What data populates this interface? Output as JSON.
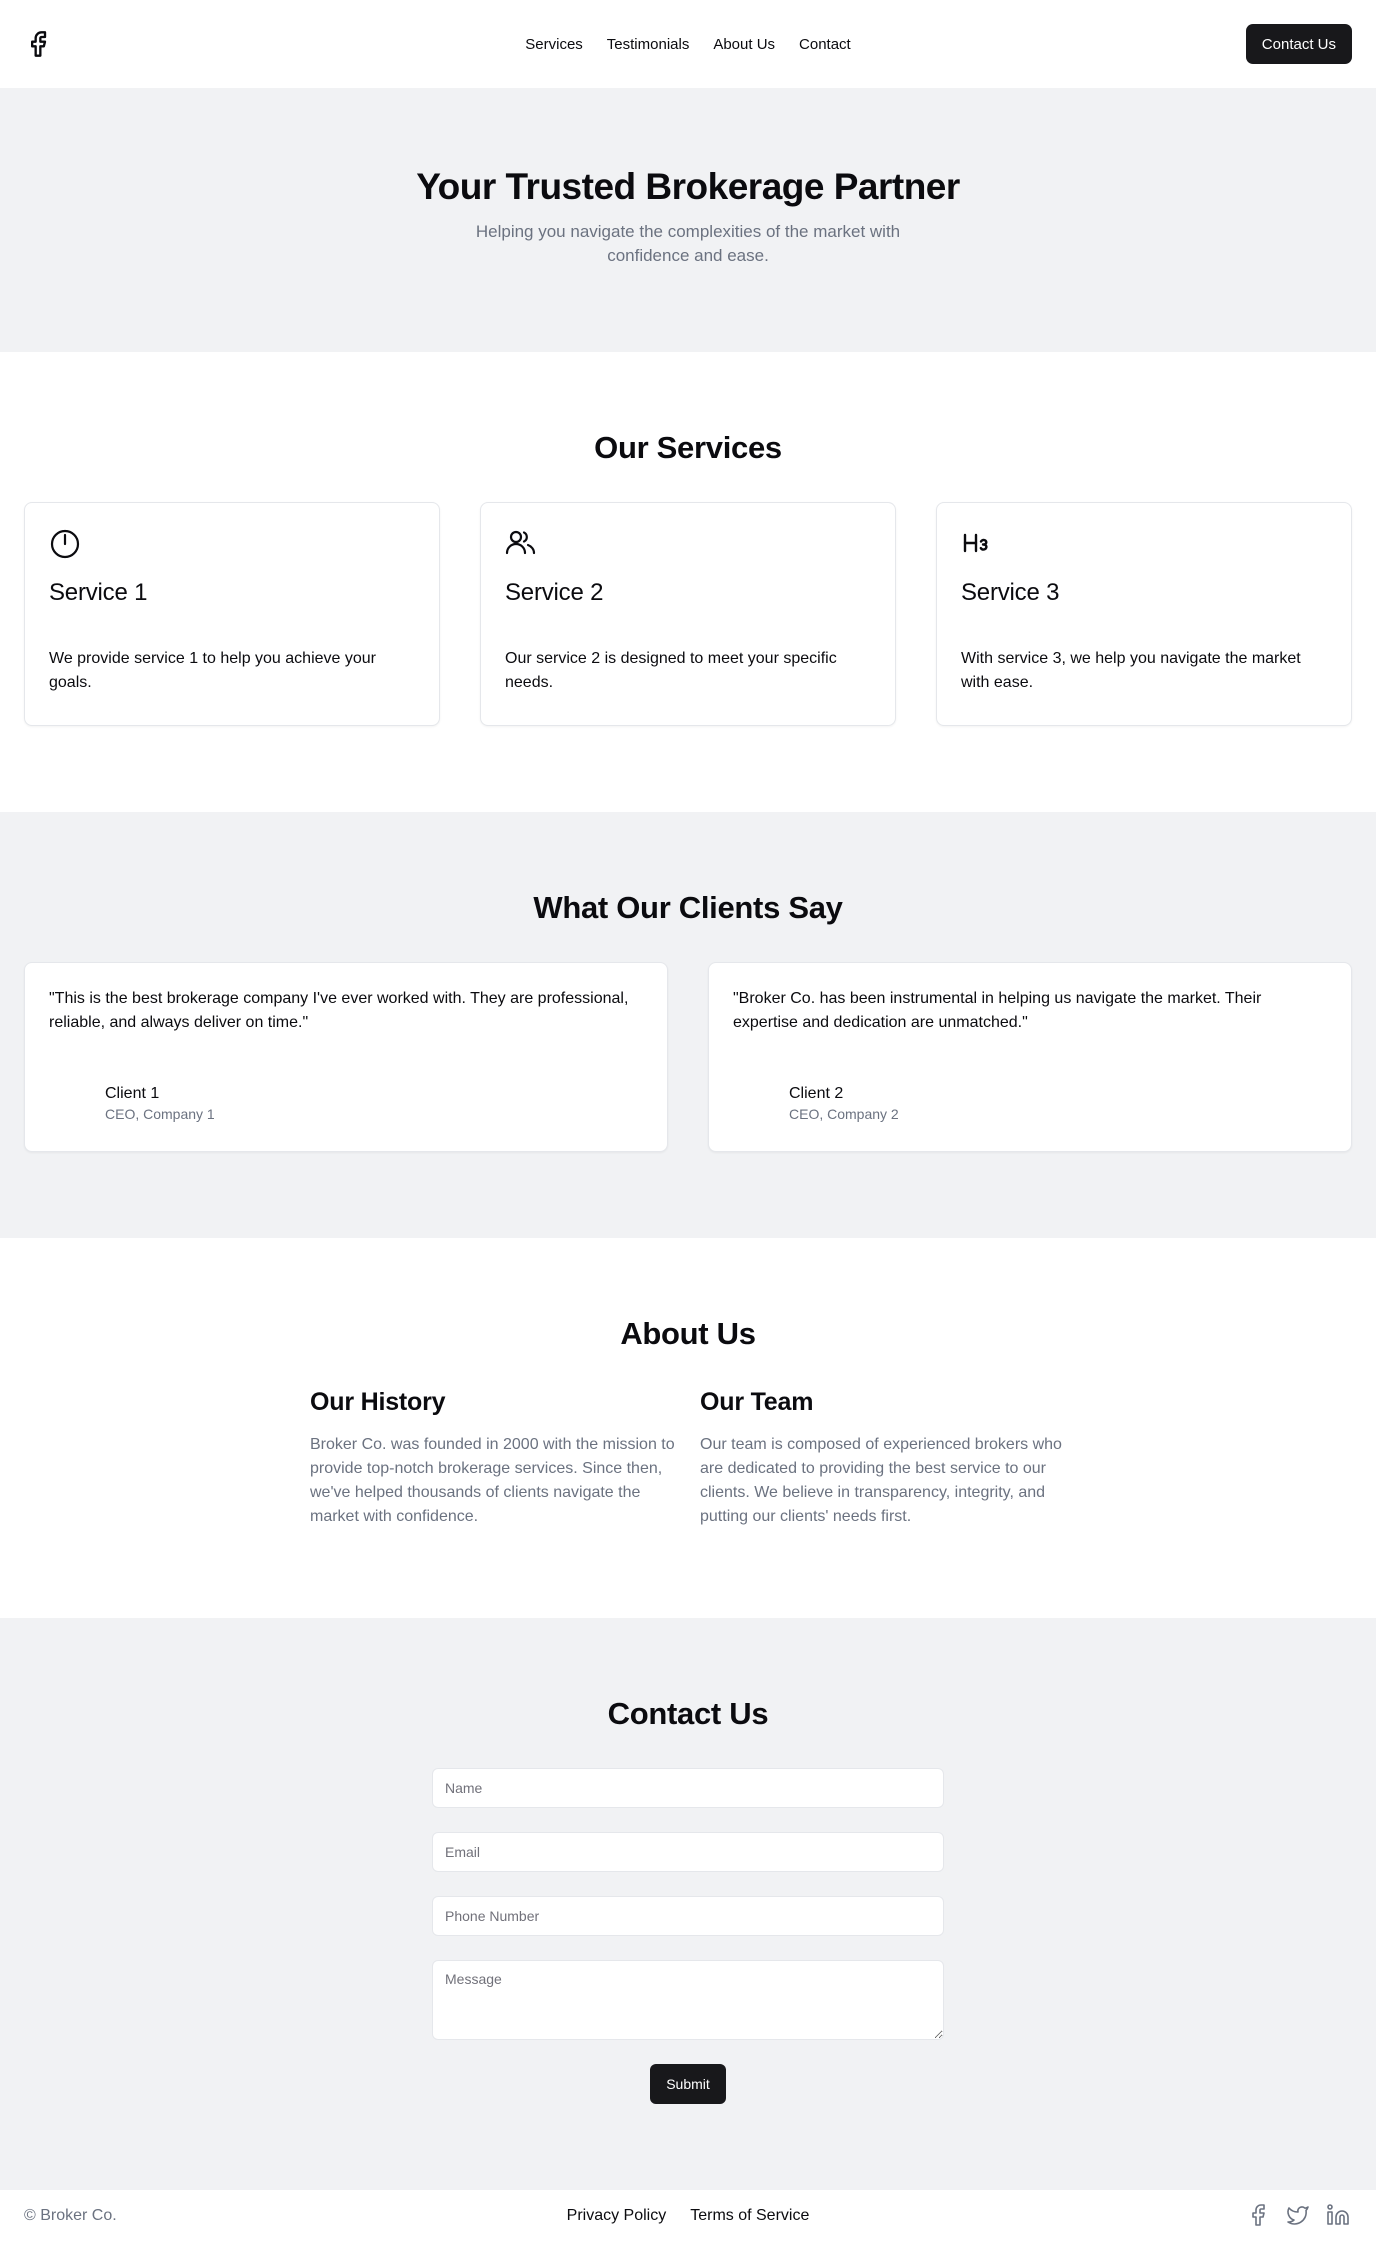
{
  "header": {
    "logo_icon": "facebook-icon",
    "nav": [
      {
        "label": "Services"
      },
      {
        "label": "Testimonials"
      },
      {
        "label": "About Us"
      },
      {
        "label": "Contact"
      }
    ],
    "cta_label": "Contact Us"
  },
  "hero": {
    "title": "Your Trusted Brokerage Partner",
    "subtitle": "Helping you navigate the complexities of the market with confidence and ease."
  },
  "services": {
    "title": "Our Services",
    "items": [
      {
        "icon": "gauge-icon",
        "title": "Service 1",
        "description": "We provide service 1 to help you achieve your goals."
      },
      {
        "icon": "users-icon",
        "title": "Service 2",
        "description": "Our service 2 is designed to meet your specific needs."
      },
      {
        "icon": "heading-3-icon",
        "title": "Service 3",
        "description": "With service 3, we help you navigate the market with ease."
      }
    ]
  },
  "testimonials": {
    "title": "What Our Clients Say",
    "items": [
      {
        "quote": "\"This is the best brokerage company I've ever worked with. They are professional, reliable, and always deliver on time.\"",
        "name": "Client 1",
        "role": "CEO, Company 1"
      },
      {
        "quote": "\"Broker Co. has been instrumental in helping us navigate the market. Their expertise and dedication are unmatched.\"",
        "name": "Client 2",
        "role": "CEO, Company 2"
      }
    ]
  },
  "about": {
    "title": "About Us",
    "history": {
      "title": "Our History",
      "text": "Broker Co. was founded in 2000 with the mission to provide top-notch brokerage services. Since then, we've helped thousands of clients navigate the market with confidence."
    },
    "team": {
      "title": "Our Team",
      "text": "Our team is composed of experienced brokers who are dedicated to providing the best service to our clients. We believe in transparency, integrity, and putting our clients' needs first."
    }
  },
  "contact": {
    "title": "Contact Us",
    "fields": {
      "name_placeholder": "Name",
      "email_placeholder": "Email",
      "phone_placeholder": "Phone Number",
      "message_placeholder": "Message"
    },
    "submit_label": "Submit"
  },
  "footer": {
    "copyright": "© Broker Co.",
    "links": [
      {
        "label": "Privacy Policy"
      },
      {
        "label": "Terms of Service"
      }
    ],
    "social_icons": [
      "facebook-icon",
      "twitter-icon",
      "linkedin-icon"
    ]
  },
  "colors": {
    "primary": "#18181b",
    "muted_text": "#6b7280",
    "section_alt_bg": "#f1f2f4",
    "border": "#e5e7eb"
  }
}
